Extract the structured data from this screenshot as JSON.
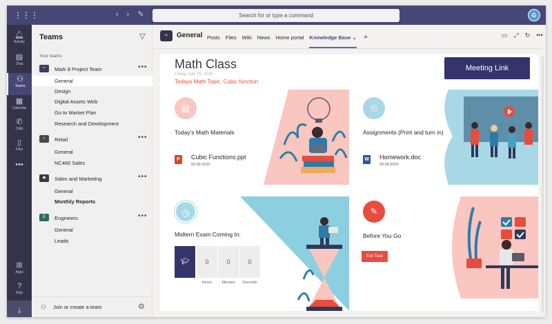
{
  "topbar": {
    "search_placeholder": "Search for or type a command",
    "avatar_initials": "G"
  },
  "rail": [
    {
      "label": "Activity",
      "icon": "bell-icon"
    },
    {
      "label": "Chat",
      "icon": "chat-icon"
    },
    {
      "label": "Teams",
      "icon": "teams-icon"
    },
    {
      "label": "Calendar",
      "icon": "calendar-icon"
    },
    {
      "label": "Calls",
      "icon": "phone-icon"
    },
    {
      "label": "Files",
      "icon": "file-icon"
    },
    {
      "label": "",
      "icon": "more-icon"
    },
    {
      "label": "Apps",
      "icon": "apps-icon"
    },
    {
      "label": "Help",
      "icon": "help-icon"
    }
  ],
  "teams_panel": {
    "title": "Teams",
    "subtitle": "Your teams",
    "join_label": "Join or create a team",
    "teams": [
      {
        "name": "Mark 8 Project Team",
        "channels": [
          "General",
          "Design",
          "Digital Assets Web",
          "Go to Market Plan",
          "Research and Development"
        ]
      },
      {
        "name": "Retail",
        "channels": [
          "General",
          "NC460 Sales"
        ]
      },
      {
        "name": "Sales and Marketing",
        "channels": [
          "General",
          "Monthly Reports"
        ]
      },
      {
        "name": "Engineers",
        "channels": [
          "General",
          "Leads"
        ]
      }
    ]
  },
  "channel": {
    "name": "General",
    "tabs": [
      "Posts",
      "Files",
      "Wiki",
      "News",
      "Home portal",
      "Knowledge Base"
    ],
    "active_tab": "Knowledge Base"
  },
  "page": {
    "title": "Math Class",
    "date": "Friday, July 15, 2020",
    "topic": "Todays Math Topic: Cubic function",
    "meeting_button": "Meeting Link",
    "materials_title": "Today's Math Materials",
    "materials_file": {
      "name": "Cubic Functions.ppt",
      "date": "09.08.2020"
    },
    "assignments_title": "Assignments (Print and turn in)",
    "assignments_file": {
      "name": "Homework.doc",
      "date": "09.08.2020"
    },
    "exam_title": "Midtern Exam Coming In:",
    "countdown": {
      "values": [
        "0",
        "0",
        "0"
      ],
      "labels": [
        "Hours",
        "Minutes",
        "Seconds"
      ]
    },
    "before_title": "Before You Go",
    "exit_button": "Exit Task"
  },
  "colors": {
    "topbar": "#464775",
    "rail": "#33344a",
    "accent": "#6264a7",
    "meeting_button": "#33346b",
    "red": "#e74c3c",
    "pink": "#f9c6c0",
    "teal": "#7ec4d8"
  }
}
